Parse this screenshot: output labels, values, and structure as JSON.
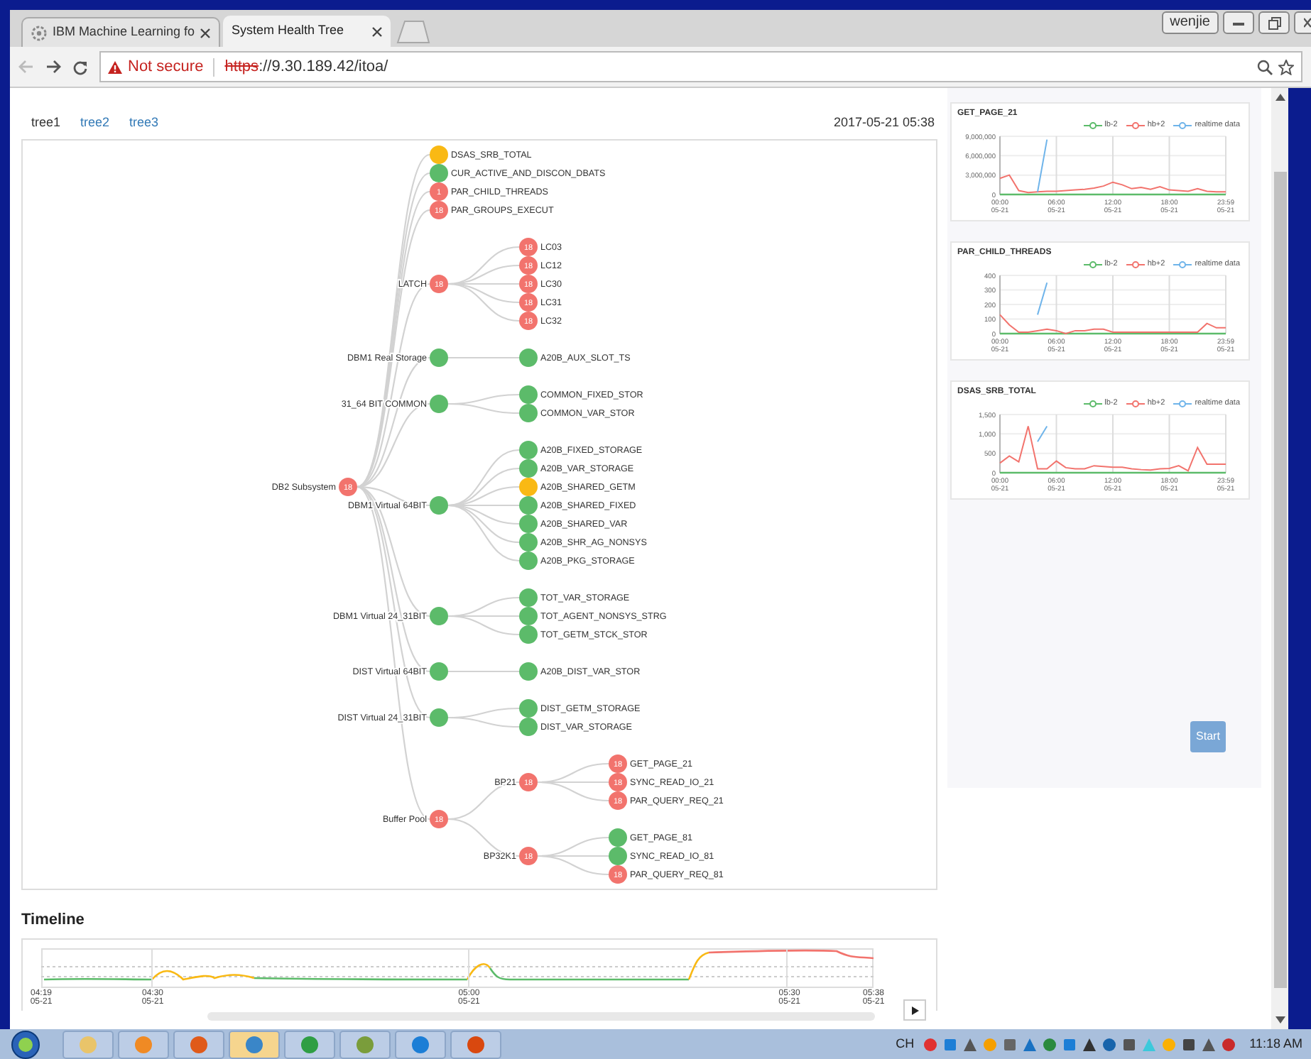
{
  "browser": {
    "tabs": [
      {
        "title": "IBM Machine Learning fo",
        "selected": false,
        "icon": true
      },
      {
        "title": "System Health Tree",
        "selected": true,
        "icon": false
      }
    ],
    "user": "wenjie",
    "security": "Not secure",
    "url_scheme": "https",
    "url_rest": "://9.30.189.42/itoa/"
  },
  "page_tabs": [
    {
      "label": "tree1",
      "selected": true
    },
    {
      "label": "tree2",
      "selected": false
    },
    {
      "label": "tree3",
      "selected": false
    }
  ],
  "timestamp": "2017-05-21 05:38",
  "tree": {
    "label": "DB2 Subsystem",
    "color": "#f2736d",
    "badge": "18",
    "children": [
      {
        "label": "DSAS_SRB_TOTAL",
        "color": "#f9b914"
      },
      {
        "label": "CUR_ACTIVE_AND_DISCON_DBATS",
        "color": "#5cbb6a"
      },
      {
        "label": "PAR_CHILD_THREADS",
        "color": "#f2736d",
        "badge": "1"
      },
      {
        "label": "PAR_GROUPS_EXECUT",
        "color": "#f2736d",
        "badge": "18"
      },
      {
        "label": "LATCH",
        "color": "#f2736d",
        "badge": "18",
        "children": [
          {
            "label": "LC03",
            "color": "#f2736d",
            "badge": "18"
          },
          {
            "label": "LC12",
            "color": "#f2736d",
            "badge": "18"
          },
          {
            "label": "LC30",
            "color": "#f2736d",
            "badge": "18"
          },
          {
            "label": "LC31",
            "color": "#f2736d",
            "badge": "18"
          },
          {
            "label": "LC32",
            "color": "#f2736d",
            "badge": "18"
          }
        ]
      },
      {
        "label": "DBM1 Real Storage",
        "color": "#5cbb6a",
        "children": [
          {
            "label": "A20B_AUX_SLOT_TS",
            "color": "#5cbb6a"
          }
        ]
      },
      {
        "label": "31_64 BIT COMMON",
        "color": "#5cbb6a",
        "children": [
          {
            "label": "COMMON_FIXED_STOR",
            "color": "#5cbb6a"
          },
          {
            "label": "COMMON_VAR_STOR",
            "color": "#5cbb6a"
          }
        ]
      },
      {
        "label": "DBM1 Virtual 64BIT",
        "color": "#5cbb6a",
        "children": [
          {
            "label": "A20B_FIXED_STORAGE",
            "color": "#5cbb6a"
          },
          {
            "label": "A20B_VAR_STORAGE",
            "color": "#5cbb6a"
          },
          {
            "label": "A20B_SHARED_GETM",
            "color": "#f9b914"
          },
          {
            "label": "A20B_SHARED_FIXED",
            "color": "#5cbb6a"
          },
          {
            "label": "A20B_SHARED_VAR",
            "color": "#5cbb6a"
          },
          {
            "label": "A20B_SHR_AG_NONSYS",
            "color": "#5cbb6a"
          },
          {
            "label": "A20B_PKG_STORAGE",
            "color": "#5cbb6a"
          }
        ]
      },
      {
        "label": "DBM1 Virtual 24_31BIT",
        "color": "#5cbb6a",
        "children": [
          {
            "label": "TOT_VAR_STORAGE",
            "color": "#5cbb6a"
          },
          {
            "label": "TOT_AGENT_NONSYS_STRG",
            "color": "#5cbb6a"
          },
          {
            "label": "TOT_GETM_STCK_STOR",
            "color": "#5cbb6a"
          }
        ]
      },
      {
        "label": "DIST Virtual 64BIT",
        "color": "#5cbb6a",
        "children": [
          {
            "label": "A20B_DIST_VAR_STOR",
            "color": "#5cbb6a"
          }
        ]
      },
      {
        "label": "DIST Virtual 24_31BIT",
        "color": "#5cbb6a",
        "children": [
          {
            "label": "DIST_GETM_STORAGE",
            "color": "#5cbb6a"
          },
          {
            "label": "DIST_VAR_STORAGE",
            "color": "#5cbb6a"
          }
        ]
      },
      {
        "label": "Buffer Pool",
        "color": "#f2736d",
        "badge": "18",
        "children": [
          {
            "label": "BP21",
            "color": "#f2736d",
            "badge": "18",
            "children": [
              {
                "label": "GET_PAGE_21",
                "color": "#f2736d",
                "badge": "18"
              },
              {
                "label": "SYNC_READ_IO_21",
                "color": "#f2736d",
                "badge": "18"
              },
              {
                "label": "PAR_QUERY_REQ_21",
                "color": "#f2736d",
                "badge": "18"
              }
            ]
          },
          {
            "label": "BP32K1",
            "color": "#f2736d",
            "badge": "18",
            "children": [
              {
                "label": "GET_PAGE_81",
                "color": "#5cbb6a"
              },
              {
                "label": "SYNC_READ_IO_81",
                "color": "#5cbb6a"
              },
              {
                "label": "PAR_QUERY_REQ_81",
                "color": "#f2736d",
                "badge": "18"
              }
            ]
          }
        ]
      }
    ]
  },
  "charts": [
    {
      "chart_data": {
        "type": "line",
        "title": "GET_PAGE_21",
        "grid": true,
        "categories": [
          "00:00\n05-21",
          null,
          null,
          null,
          null,
          null,
          "06:00\n05-21",
          null,
          null,
          null,
          null,
          null,
          "12:00\n05-21",
          null,
          null,
          null,
          null,
          null,
          "18:00\n05-21",
          null,
          null,
          null,
          null,
          null,
          "23:59\n05-21"
        ],
        "ylim": [
          0,
          9000000
        ],
        "yticks": [
          {
            "value": 0,
            "label": "0"
          },
          {
            "value": 3000000,
            "label": "3,000,000"
          },
          {
            "value": 6000000,
            "label": "6,000,000"
          },
          {
            "value": 9000000,
            "label": "9,000,000"
          }
        ],
        "series": [
          {
            "name": "lb-2",
            "color": "#5cbb6a",
            "values": [
              0,
              0,
              0,
              0,
              0,
              0,
              0,
              0,
              0,
              0,
              0,
              0,
              0,
              0,
              0,
              0,
              0,
              0,
              0,
              0,
              0,
              0,
              0,
              0,
              0
            ]
          },
          {
            "name": "hb+2",
            "color": "#f2736d",
            "values": [
              2500000,
              3000000,
              600000,
              300000,
              400000,
              500000,
              500000,
              600000,
              700000,
              800000,
              1000000,
              1300000,
              1900000,
              1500000,
              900000,
              1100000,
              800000,
              1200000,
              700000,
              600000,
              500000,
              900000,
              500000,
              400000,
              400000
            ]
          },
          {
            "name": "realtime data",
            "color": "#6fb4ea",
            "values": [
              null,
              null,
              null,
              null,
              400000,
              8500000,
              null,
              null,
              null,
              null,
              null,
              null,
              null,
              null,
              null,
              null,
              null,
              null,
              null,
              null,
              null,
              null,
              null,
              null,
              null
            ]
          }
        ]
      }
    },
    {
      "chart_data": {
        "type": "line",
        "title": "PAR_CHILD_THREADS",
        "grid": true,
        "categories": [
          "00:00\n05-21",
          null,
          null,
          null,
          null,
          null,
          "06:00\n05-21",
          null,
          null,
          null,
          null,
          null,
          "12:00\n05-21",
          null,
          null,
          null,
          null,
          null,
          "18:00\n05-21",
          null,
          null,
          null,
          null,
          null,
          "23:59\n05-21"
        ],
        "ylim": [
          0,
          400
        ],
        "yticks": [
          0,
          100,
          200,
          300,
          400
        ],
        "series": [
          {
            "name": "lb-2",
            "color": "#5cbb6a",
            "values": [
              0,
              0,
              0,
              0,
              0,
              0,
              0,
              0,
              0,
              0,
              0,
              0,
              0,
              0,
              0,
              0,
              0,
              0,
              0,
              0,
              0,
              0,
              0,
              0,
              0
            ]
          },
          {
            "name": "hb+2",
            "color": "#f2736d",
            "values": [
              130,
              60,
              10,
              10,
              20,
              30,
              20,
              0,
              20,
              20,
              30,
              30,
              10,
              10,
              10,
              10,
              10,
              10,
              10,
              10,
              10,
              10,
              70,
              40,
              40
            ]
          },
          {
            "name": "realtime data",
            "color": "#6fb4ea",
            "values": [
              null,
              null,
              null,
              null,
              130,
              350,
              null,
              null,
              null,
              null,
              null,
              null,
              null,
              null,
              null,
              null,
              null,
              null,
              null,
              null,
              null,
              null,
              null,
              null,
              null
            ]
          }
        ]
      }
    },
    {
      "chart_data": {
        "type": "line",
        "title": "DSAS_SRB_TOTAL",
        "grid": true,
        "categories": [
          "00:00\n05-21",
          null,
          null,
          null,
          null,
          null,
          "06:00\n05-21",
          null,
          null,
          null,
          null,
          null,
          "12:00\n05-21",
          null,
          null,
          null,
          null,
          null,
          "18:00\n05-21",
          null,
          null,
          null,
          null,
          null,
          "23:59\n05-21"
        ],
        "ylim": [
          0,
          1500
        ],
        "yticks": [
          {
            "value": 0,
            "label": "0"
          },
          {
            "value": 500,
            "label": "500"
          },
          {
            "value": 1000,
            "label": "1,000"
          },
          {
            "value": 1500,
            "label": "1,500"
          }
        ],
        "series": [
          {
            "name": "lb-2",
            "color": "#5cbb6a",
            "values": [
              0,
              0,
              0,
              0,
              0,
              0,
              0,
              0,
              0,
              0,
              0,
              0,
              0,
              0,
              0,
              0,
              0,
              0,
              0,
              0,
              0,
              0,
              0,
              0,
              0
            ]
          },
          {
            "name": "hb+2",
            "color": "#f2736d",
            "values": [
              250,
              430,
              280,
              1200,
              100,
              100,
              300,
              130,
              100,
              100,
              180,
              160,
              140,
              140,
              100,
              80,
              70,
              100,
              110,
              180,
              50,
              650,
              220,
              220,
              220
            ]
          },
          {
            "name": "realtime data",
            "color": "#6fb4ea",
            "values": [
              null,
              null,
              null,
              null,
              800,
              1200,
              null,
              null,
              null,
              null,
              null,
              null,
              null,
              null,
              null,
              null,
              null,
              null,
              null,
              null,
              null,
              null,
              null,
              null,
              null
            ]
          }
        ]
      }
    }
  ],
  "start_button": "Start",
  "timeline": {
    "title": "Timeline",
    "ticks": [
      {
        "time": "04:19",
        "date": "05-21"
      },
      {
        "time": "04:30",
        "date": "05-21"
      },
      {
        "time": "05:00",
        "date": "05-21"
      },
      {
        "time": "05:30",
        "date": "05-21"
      },
      {
        "time": "05:38",
        "date": "05-21"
      }
    ]
  },
  "taskbar": {
    "language": "CH",
    "clock": "11:18 AM"
  }
}
